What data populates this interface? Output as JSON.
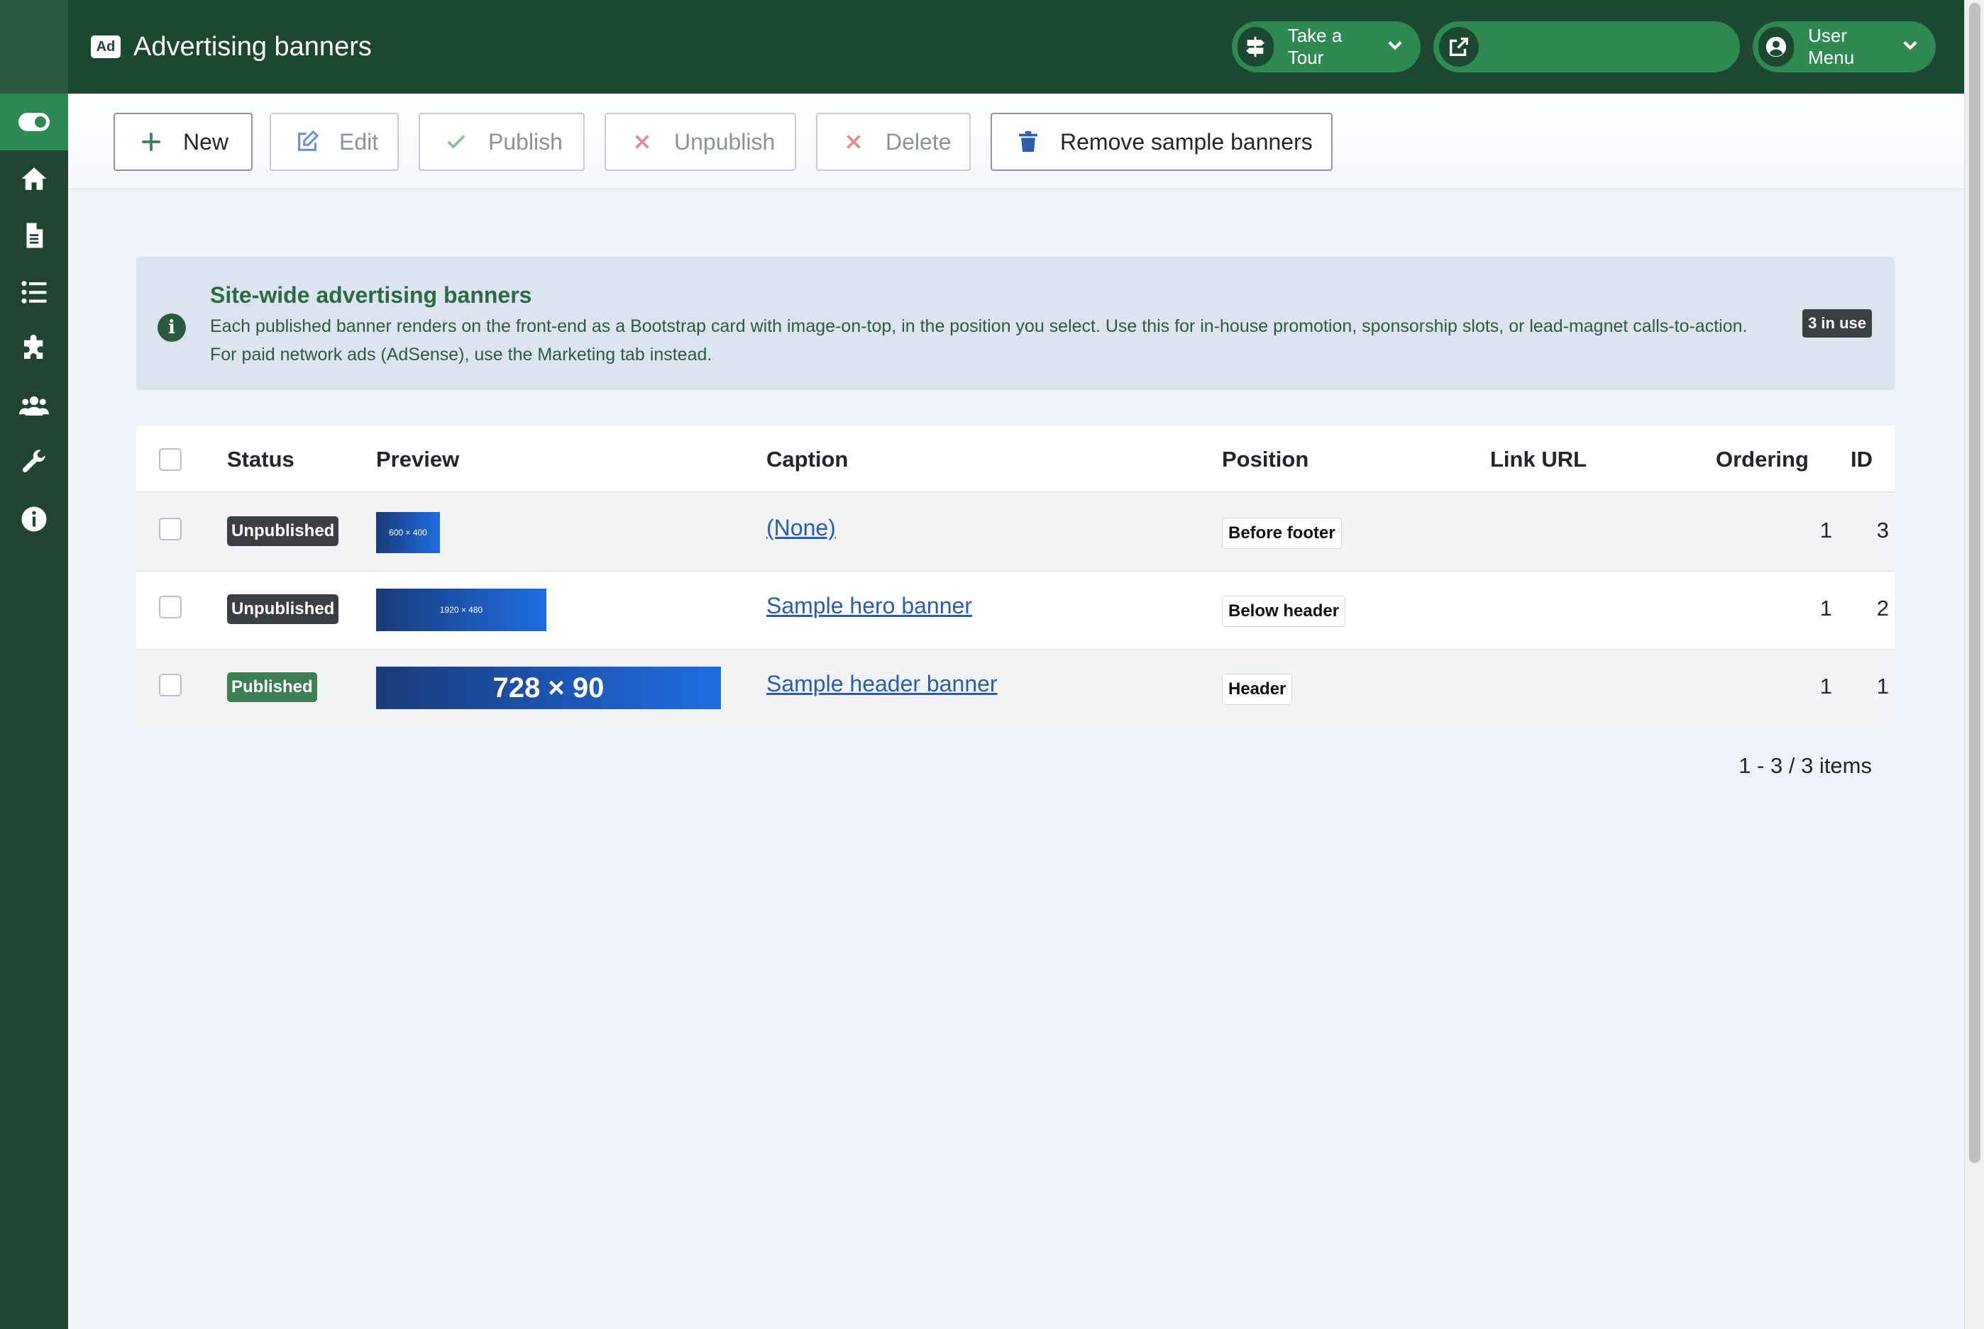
{
  "header": {
    "badge": "Ad",
    "title": "Advertising banners",
    "tour_label": "Take a Tour",
    "site_label": "",
    "user_label": "User Menu"
  },
  "toolbar": {
    "new_label": "New",
    "edit_label": "Edit",
    "publish_label": "Publish",
    "unpublish_label": "Unpublish",
    "delete_label": "Delete",
    "remove_samples_label": "Remove sample banners"
  },
  "sidebar": {
    "items": [
      "toggle-menu-icon",
      "home-icon",
      "content-icon",
      "menus-icon",
      "extensions-icon",
      "users-icon",
      "system-icon",
      "help-icon"
    ]
  },
  "alert": {
    "title": "Site-wide advertising banners",
    "line1": "Each published banner renders on the front-end as a Bootstrap card with image-on-top, in the position you select. Use this for in-house promotion, sponsorship slots, or lead-magnet calls-to-action.",
    "line2": "For paid network ads (AdSense), use the Marketing tab instead.",
    "badge": "3 in use"
  },
  "table": {
    "columns": {
      "status": "Status",
      "preview": "Preview",
      "caption": "Caption",
      "position": "Position",
      "link_url": "Link URL",
      "ordering": "Ordering",
      "id": "ID"
    },
    "rows": [
      {
        "status": "Unpublished",
        "preview": "600 × 400",
        "caption": "(None)",
        "position": "Before footer",
        "link_url": "",
        "ordering": "1",
        "id": "3"
      },
      {
        "status": "Unpublished",
        "preview": "1920 × 480",
        "caption": "Sample hero banner",
        "position": "Below header",
        "link_url": "",
        "ordering": "1",
        "id": "2"
      },
      {
        "status": "Published",
        "preview": "728 × 90",
        "caption": "Sample header banner",
        "position": "Header",
        "link_url": "",
        "ordering": "1",
        "id": "1"
      }
    ]
  },
  "pagination": {
    "summary": "1 - 3 / 3 items"
  },
  "colors": {
    "sidebar": "#1f4532",
    "header": "#1c4731",
    "accent": "#2f8a51",
    "link": "#2a5db0",
    "published": "#3b7f52",
    "unpublished": "#3b3f44"
  }
}
